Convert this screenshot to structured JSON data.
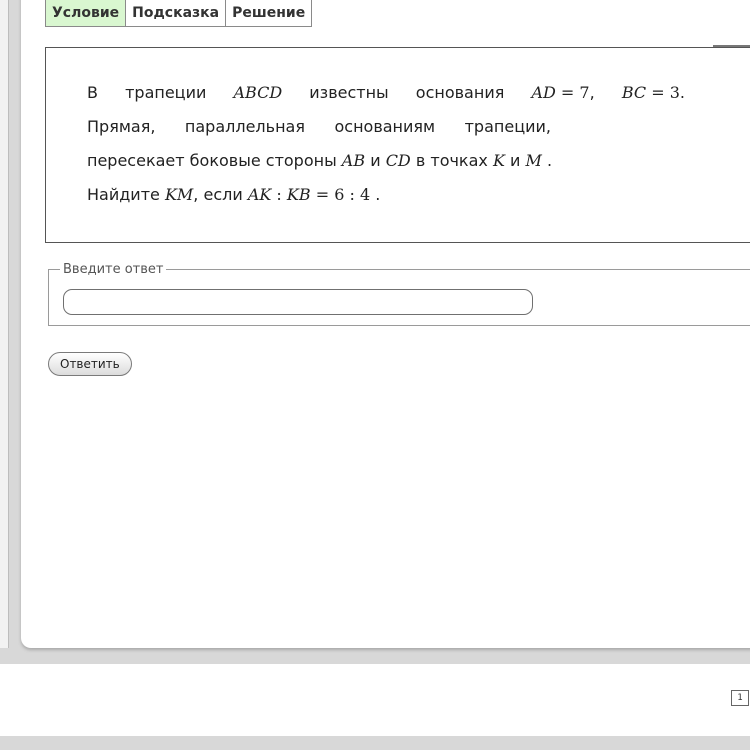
{
  "tabs": [
    {
      "label": "Условие",
      "active": true
    },
    {
      "label": "Подсказка",
      "active": false
    },
    {
      "label": "Решение",
      "active": false
    }
  ],
  "task": {
    "l1_w1": "В",
    "l1_w2": "трапеции",
    "l1_abcd": "ABCD",
    "l1_w3": "известны",
    "l1_w4": "основания",
    "l1_ad": "AD",
    "l1_eq1": " = 7",
    "l1_bc": "BC",
    "l1_eq2": " = 3",
    "l2_w1": "Прямая,",
    "l2_w2": "параллельная",
    "l2_w3": "основаниям",
    "l2_w4": "трапеции,",
    "l3_t1": "пересекает боковые стороны ",
    "l3_ab": "AB",
    "l3_t2": " и ",
    "l3_cd": "CD",
    "l3_t3": " в точках ",
    "l3_k": "K",
    "l3_t4": " и ",
    "l3_m": "M",
    "l3_t5": " .",
    "l4_t1": "Найдите ",
    "l4_km": "KM",
    "l4_t2": ", если ",
    "l4_ak": "AK",
    "l4_colon": " : ",
    "l4_kb": "KB",
    "l4_eq": " = 6 : 4",
    "l4_dot": " ."
  },
  "answer": {
    "legend": "Введите ответ",
    "value": "",
    "placeholder": ""
  },
  "submit_label": "Ответить",
  "page_number": "1",
  "colors": {
    "active_tab": "#d9f7d0",
    "panel": "#ffffff",
    "background": "#d8d8d8"
  }
}
